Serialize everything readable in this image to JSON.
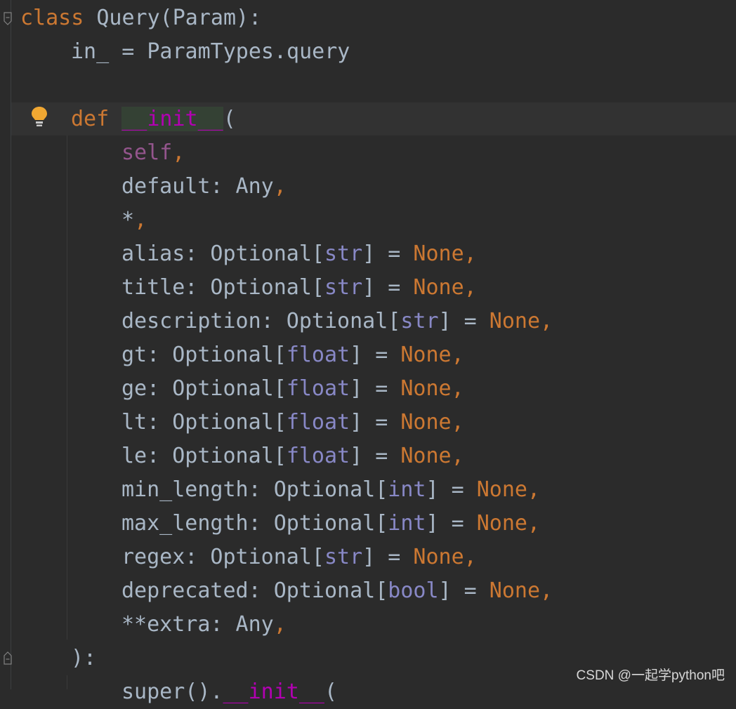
{
  "code": {
    "line1": {
      "kw": "class",
      "name": " Query(Param):"
    },
    "line2": {
      "text": "in_ = ParamTypes.query"
    },
    "line4": {
      "kw": "def",
      "magic": "__init__",
      "tail": "("
    },
    "line5": {
      "self": "self",
      "comma": ","
    },
    "line6": {
      "text": "default: Any",
      "comma": ","
    },
    "line7": {
      "text": "*",
      "comma": ","
    },
    "params": [
      {
        "name": "alias: Optional[",
        "type": "str",
        "mid": "] = ",
        "val": "None",
        "comma": ","
      },
      {
        "name": "title: Optional[",
        "type": "str",
        "mid": "] = ",
        "val": "None",
        "comma": ","
      },
      {
        "name": "description: Optional[",
        "type": "str",
        "mid": "] = ",
        "val": "None",
        "comma": ","
      },
      {
        "name": "gt: Optional[",
        "type": "float",
        "mid": "] = ",
        "val": "None",
        "comma": ","
      },
      {
        "name": "ge: Optional[",
        "type": "float",
        "mid": "] = ",
        "val": "None",
        "comma": ","
      },
      {
        "name": "lt: Optional[",
        "type": "float",
        "mid": "] = ",
        "val": "None",
        "comma": ","
      },
      {
        "name": "le: Optional[",
        "type": "float",
        "mid": "] = ",
        "val": "None",
        "comma": ","
      },
      {
        "name": "min_length: Optional[",
        "type": "int",
        "mid": "] = ",
        "val": "None",
        "comma": ","
      },
      {
        "name": "max_length: Optional[",
        "type": "int",
        "mid": "] = ",
        "val": "None",
        "comma": ","
      },
      {
        "name": "regex: Optional[",
        "type": "str",
        "mid": "] = ",
        "val": "None",
        "comma": ","
      },
      {
        "name": "deprecated: Optional[",
        "type": "bool",
        "mid": "] = ",
        "val": "None",
        "comma": ","
      }
    ],
    "extra": {
      "text": "**extra: Any",
      "comma": ","
    },
    "close": {
      "text": "):"
    },
    "super_line": {
      "a": "super().",
      "magic": "__init__",
      "b": "("
    }
  },
  "watermark": "CSDN @一起学python吧",
  "colors": {
    "background": "#2b2b2b",
    "keyword": "#cc7832",
    "identifier": "#a9b7c6",
    "self": "#94558d",
    "magic_method": "#b200b2",
    "builtin_type": "#8888c6"
  },
  "icons": [
    "fold-icon",
    "lightbulb-icon"
  ]
}
